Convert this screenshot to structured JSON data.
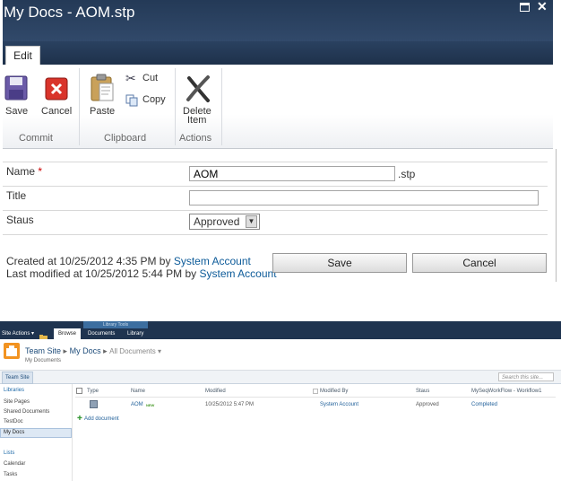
{
  "dialog": {
    "title": "My Docs - AOM.stp",
    "ribbon": {
      "tabs": [
        "Edit"
      ],
      "groups": {
        "commit": {
          "label": "Commit",
          "save": "Save",
          "cancel": "Cancel"
        },
        "clipboard": {
          "label": "Clipboard",
          "paste": "Paste",
          "cut": "Cut",
          "copy": "Copy"
        },
        "actions": {
          "label": "Actions",
          "delete_line1": "Delete",
          "delete_line2": "Item"
        }
      }
    },
    "form": {
      "name_label": "Name",
      "required_mark": "*",
      "name_value": "AOM",
      "name_suffix": ".stp",
      "title_label": "Title",
      "title_value": "",
      "status_label": "Staus",
      "status_value": "Approved"
    },
    "meta": {
      "created_prefix": "Created at 10/25/2012 4:35 PM  by",
      "created_by": "System Account",
      "modified_prefix": "Last modified at 10/25/2012 5:44 PM  by",
      "modified_by": "System Account"
    },
    "buttons": {
      "save": "Save",
      "cancel": "Cancel"
    }
  },
  "sharepoint": {
    "site_actions": "Site Actions ▾",
    "library_tools": "Library Tools",
    "tabs": [
      "Browse",
      "Documents",
      "Library"
    ],
    "breadcrumb": {
      "site": "Team Site",
      "sep1": "▸",
      "list": "My Docs",
      "sep2": "▸",
      "view": "All Documents ▾",
      "sub": "My Documents"
    },
    "topnav_item": "Team Site",
    "search_placeholder": "Search this site...",
    "quicklaunch": {
      "libraries_head": "Libraries",
      "libraries": [
        "Site Pages",
        "Shared Documents",
        "TestDoc",
        "My Docs"
      ],
      "lists_head": "Lists",
      "lists": [
        "Calendar",
        "Tasks"
      ]
    },
    "table": {
      "headers": [
        "Type",
        "Name",
        "Modified",
        "Modified By",
        "Staus",
        "MySeqWorkFlow - Workflow1"
      ],
      "row": {
        "name": "AOM",
        "new_badge": "NEW",
        "modified": "10/25/2012 5:47 PM",
        "modified_by": "System Account",
        "status": "Approved",
        "workflow": "Completed"
      },
      "add_link": "Add document"
    }
  },
  "colors": {
    "titlebar": "#243a57",
    "link": "#0d5b99",
    "accent": "#f29320"
  }
}
